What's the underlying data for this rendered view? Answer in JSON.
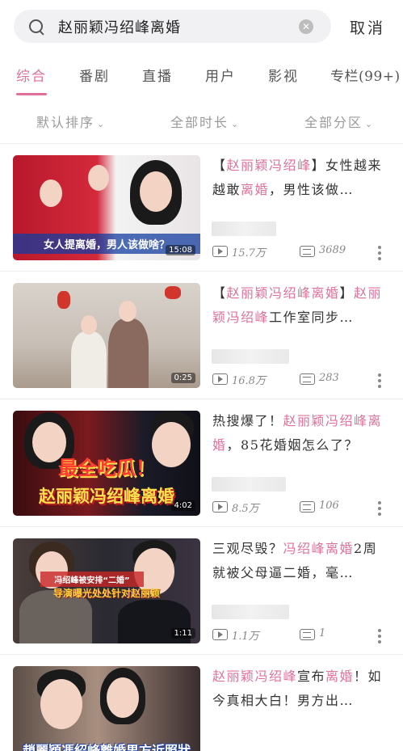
{
  "search": {
    "query": "赵丽颖冯绍峰离婚",
    "cancel_label": "取消"
  },
  "tabs": [
    {
      "label": "综合",
      "active": true
    },
    {
      "label": "番剧",
      "active": false
    },
    {
      "label": "直播",
      "active": false
    },
    {
      "label": "用户",
      "active": false
    },
    {
      "label": "影视",
      "active": false
    },
    {
      "label": "专栏(99+)",
      "active": false
    }
  ],
  "filters": [
    {
      "label": "默认排序"
    },
    {
      "label": "全部时长"
    },
    {
      "label": "全部分区"
    }
  ],
  "colors": {
    "accent": "#e0709a",
    "muted": "#9a9a9a"
  },
  "videos": [
    {
      "title_parts": [
        {
          "text": "【",
          "hl": false
        },
        {
          "text": "赵丽颖冯绍峰",
          "hl": true
        },
        {
          "text": "】女性越来越敢",
          "hl": false
        },
        {
          "text": "离婚",
          "hl": true
        },
        {
          "text": "，男性该做…",
          "hl": false
        }
      ],
      "thumb_caption": "女人提离婚，男人该做啥？",
      "duration": "15:08",
      "plays": "15.7万",
      "comments": "3689"
    },
    {
      "title_parts": [
        {
          "text": "【",
          "hl": false
        },
        {
          "text": "赵丽颖冯绍峰离婚",
          "hl": true
        },
        {
          "text": "】",
          "hl": false
        },
        {
          "text": "赵丽颖冯绍峰",
          "hl": true
        },
        {
          "text": "工作室同步…",
          "hl": false
        }
      ],
      "thumb_caption": "",
      "duration": "0:25",
      "plays": "16.8万",
      "comments": "283"
    },
    {
      "title_parts": [
        {
          "text": "热搜爆了！",
          "hl": false
        },
        {
          "text": "赵丽颖冯绍峰离婚",
          "hl": true
        },
        {
          "text": "，85花婚姻怎么了？",
          "hl": false
        }
      ],
      "thumb_caption": "最全吃瓜！",
      "thumb_caption_2": "赵丽颖冯绍峰离婚",
      "duration": "4:02",
      "plays": "8.5万",
      "comments": "106"
    },
    {
      "title_parts": [
        {
          "text": "三观尽毁？",
          "hl": false
        },
        {
          "text": "冯绍峰离婚",
          "hl": true
        },
        {
          "text": "2周就被父母逼二婚，毫…",
          "hl": false
        }
      ],
      "thumb_caption": "冯绍峰被安排“二婚”",
      "thumb_caption_2": "导演曝光处处针对赵丽颖",
      "duration": "1:11",
      "plays": "1.1万",
      "comments": "1"
    },
    {
      "title_parts": [
        {
          "text": "赵丽颖冯绍峰",
          "hl": true
        },
        {
          "text": "宣布",
          "hl": false
        },
        {
          "text": "离婚",
          "hl": true
        },
        {
          "text": "！如今真相大白！男方出…",
          "hl": false
        }
      ],
      "thumb_caption": "趙麗穎馮紹峰離婚男方近照狀",
      "duration": "",
      "plays": "",
      "comments": ""
    }
  ]
}
